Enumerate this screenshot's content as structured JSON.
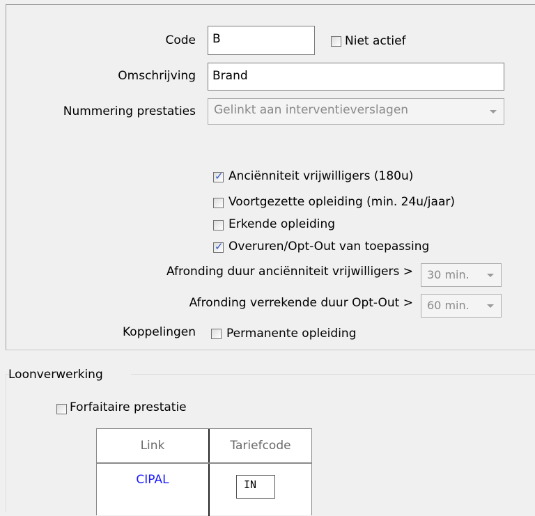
{
  "form": {
    "code_label": "Code",
    "code_value": "B",
    "niet_actief_label": "Niet actief",
    "niet_actief_checked": false,
    "omschrijving_label": "Omschrijving",
    "omschrijving_value": "Brand",
    "nummering_label": "Nummering prestaties",
    "nummering_value": "Gelinkt aan interventieverslagen",
    "options": [
      {
        "label": "Anciënniteit vrijwilligers (180u)",
        "checked": true
      },
      {
        "label": "Voortgezette opleiding (min. 24u/jaar)",
        "checked": false
      },
      {
        "label": "Erkende opleiding",
        "checked": false
      },
      {
        "label": "Overuren/Opt-Out van toepassing",
        "checked": true
      }
    ],
    "afronding_anciennitеit_label": "Afronding duur anciënniteit vrijwilligers >",
    "afronding_ancienniteit_value": "30 min.",
    "afronding_optout_label": "Afronding verrekende duur Opt-Out >",
    "afronding_optout_value": "60 min.",
    "koppelingen_label": "Koppelingen",
    "permanente_opleiding_label": "Permanente opleiding",
    "permanente_opleiding_checked": false
  },
  "loonverwerking": {
    "group_label": "Loonverwerking",
    "forfaitaire_label": "Forfaitaire prestatie",
    "forfaitaire_checked": false,
    "table": {
      "headers": [
        "Link",
        "Tariefcode"
      ],
      "rows": [
        {
          "link": "CIPAL",
          "tariefcode": "IN"
        }
      ]
    }
  }
}
